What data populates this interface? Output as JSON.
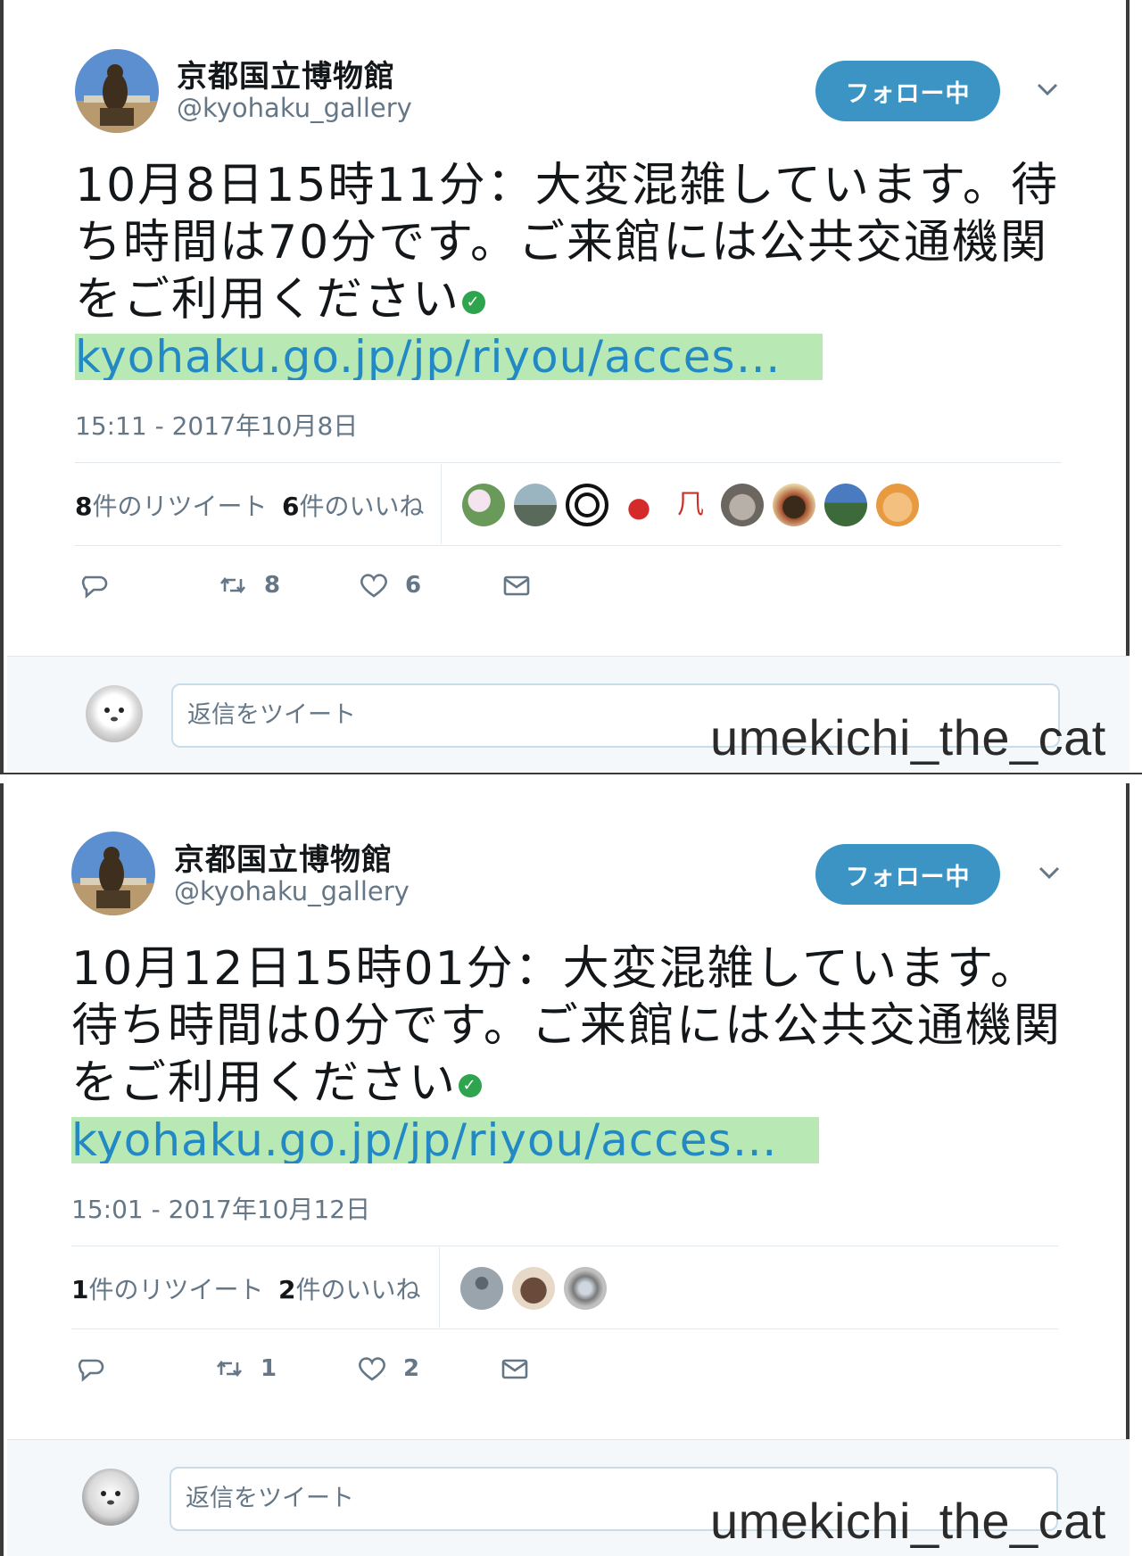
{
  "tweets": [
    {
      "account_name": "京都国立博物館",
      "handle": "@kyohaku_gallery",
      "follow_label": "フォロー中",
      "text": "10月8日15時11分：大変混雑しています。待ち時間は70分です。ご来館には公共交通機関をご利用ください",
      "link": "kyohaku.go.jp/jp/riyou/acces…",
      "timestamp": "15:11 - 2017年10月8日",
      "retweet_count": "8",
      "retweet_suffix": "件のリツイート",
      "like_count": "6",
      "like_suffix": "件のいいね",
      "action_retweets": "8",
      "action_likes": "6",
      "liker_faces": [
        "flowers",
        "temple",
        "crest",
        "mascot",
        "seal",
        "cat",
        "food",
        "landscape",
        "character"
      ],
      "reply_placeholder": "返信をツイート",
      "watermark": "umekichi_the_cat"
    },
    {
      "account_name": "京都国立博物館",
      "handle": "@kyohaku_gallery",
      "follow_label": "フォロー中",
      "text": "10月12日15時01分：大変混雑しています。待ち時間は0分です。ご来館には公共交通機関をご利用ください",
      "link": "kyohaku.go.jp/jp/riyou/acces…",
      "timestamp": "15:01 - 2017年10月12日",
      "retweet_count": "1",
      "retweet_suffix": "件のリツイート",
      "like_count": "2",
      "like_suffix": "件のいいね",
      "action_retweets": "1",
      "action_likes": "2",
      "liker_faces": [
        "default-user",
        "animal",
        "figure"
      ],
      "reply_placeholder": "返信をツイート",
      "watermark": "umekichi_the_cat"
    }
  ],
  "colors": {
    "follow_button": "#3b94c4",
    "link_text": "#2389c4",
    "link_highlight": "#b8e8b4",
    "verified_green": "#2ea44f",
    "muted": "#657786"
  }
}
